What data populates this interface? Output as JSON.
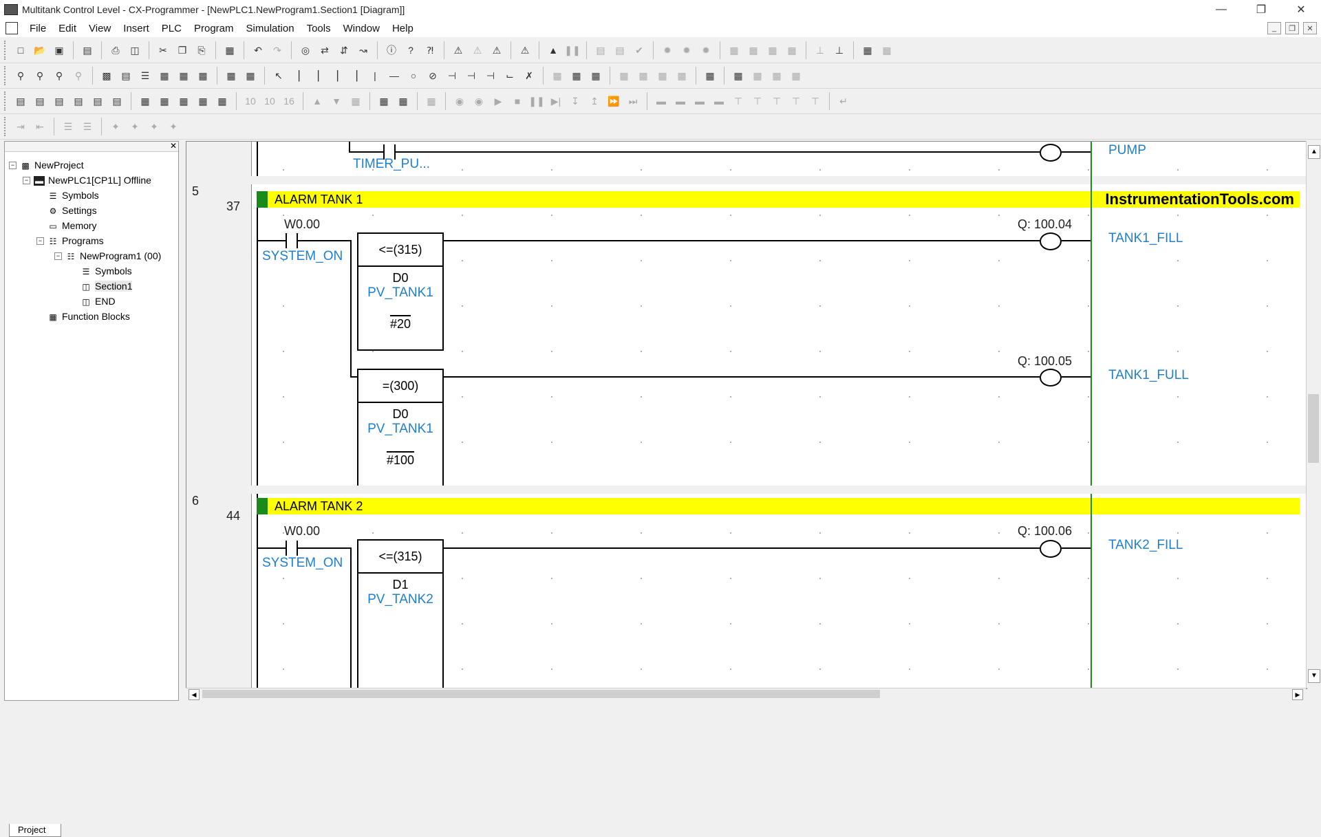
{
  "window": {
    "title": "Multitank Control Level - CX-Programmer - [NewPLC1.NewProgram1.Section1 [Diagram]]"
  },
  "menu": [
    "File",
    "Edit",
    "View",
    "Insert",
    "PLC",
    "Program",
    "Simulation",
    "Tools",
    "Window",
    "Help"
  ],
  "tree": {
    "project": "NewProject",
    "plc": "NewPLC1[CP1L] Offline",
    "symbols": "Symbols",
    "settings": "Settings",
    "memory": "Memory",
    "programs": "Programs",
    "program": "NewProgram1 (00)",
    "prog_symbols": "Symbols",
    "section": "Section1",
    "end": "END",
    "function_blocks": "Function Blocks",
    "tab": "Project"
  },
  "diagram": {
    "top_rung": {
      "timer_label": "TIMER_PU...",
      "coil_label": "PUMP"
    },
    "brand": "InstrumentationTools.com",
    "rung5": {
      "number": "5",
      "step": "37",
      "comment": "ALARM TANK 1",
      "contact_addr": "W0.00",
      "contact_label": "SYSTEM_ON",
      "cmp1": {
        "op": "<=(315)",
        "operand1": "D0",
        "operand1_label": "PV_TANK1",
        "operand2": "#20"
      },
      "coil1": {
        "addr": "Q: 100.04",
        "label": "TANK1_FILL"
      },
      "cmp2": {
        "op": "=(300)",
        "operand1": "D0",
        "operand1_label": "PV_TANK1",
        "operand2": "#100"
      },
      "coil2": {
        "addr": "Q: 100.05",
        "label": "TANK1_FULL"
      }
    },
    "rung6": {
      "number": "6",
      "step": "44",
      "comment": "ALARM TANK 2",
      "contact_addr": "W0.00",
      "contact_label": "SYSTEM_ON",
      "cmp1": {
        "op": "<=(315)",
        "operand1": "D1",
        "operand1_label": "PV_TANK2"
      },
      "coil1": {
        "addr": "Q: 100.06",
        "label": "TANK2_FILL"
      }
    }
  }
}
